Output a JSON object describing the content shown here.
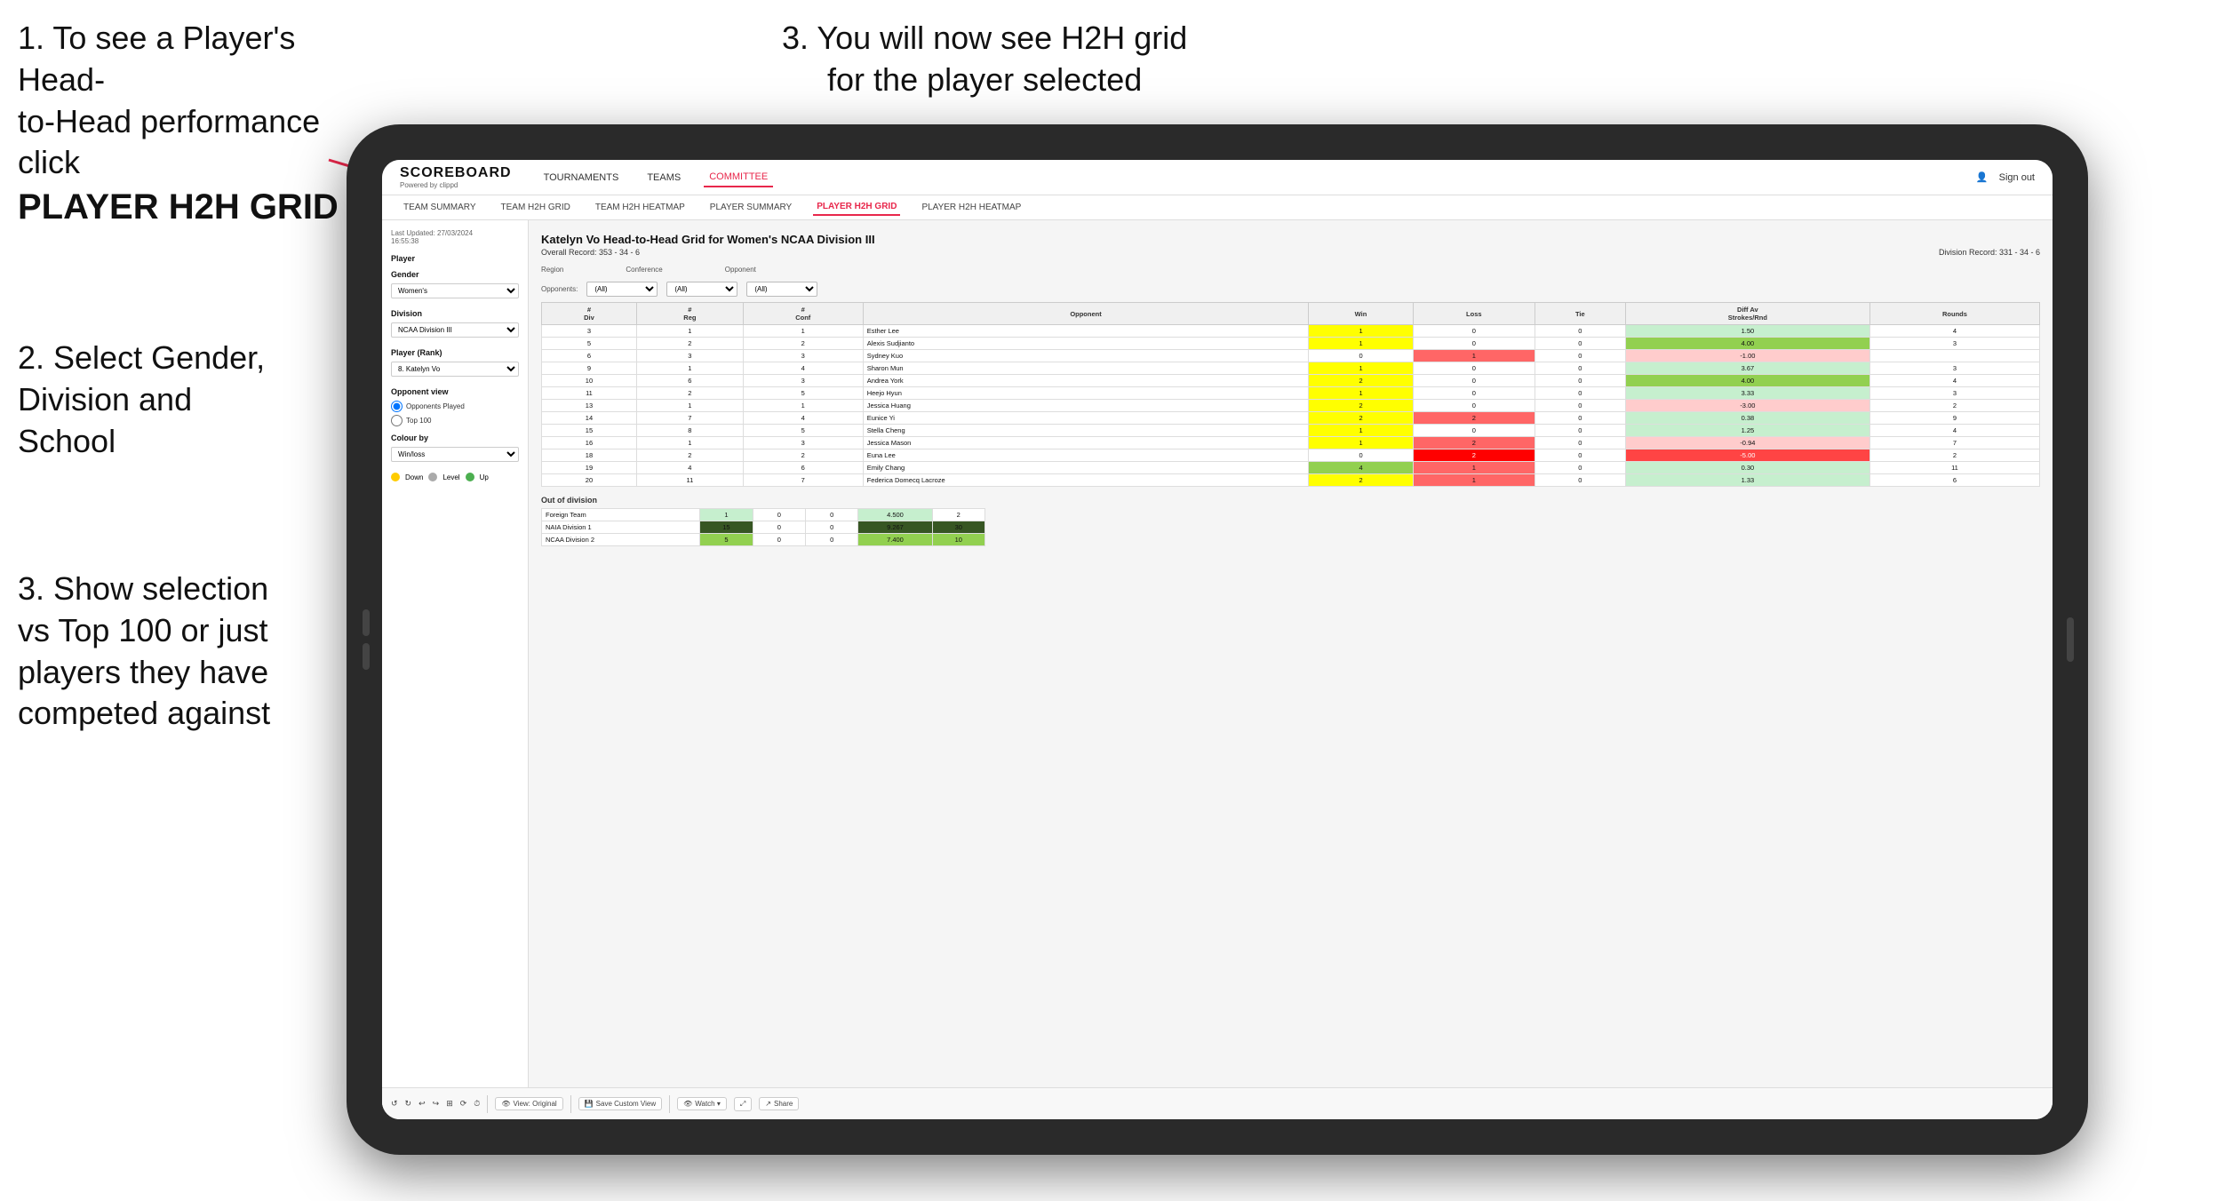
{
  "instructions": {
    "top_left_line1": "1. To see a Player's Head-",
    "top_left_line2": "to-Head performance click",
    "top_left_bold": "PLAYER H2H GRID",
    "top_right": "3. You will now see H2H grid\nfor the player selected",
    "mid_left_line1": "2. Select Gender,",
    "mid_left_line2": "Division and",
    "mid_left_line3": "School",
    "bottom_left_line1": "3. Show selection",
    "bottom_left_line2": "vs Top 100 or just",
    "bottom_left_line3": "players they have",
    "bottom_left_line4": "competed against"
  },
  "navbar": {
    "logo": "SCOREBOARD",
    "logo_sub": "Powered by clippd",
    "nav_items": [
      "TOURNAMENTS",
      "TEAMS",
      "COMMITTEE"
    ],
    "active_nav": "COMMITTEE",
    "sign_in": "Sign out"
  },
  "sub_navbar": {
    "items": [
      "TEAM SUMMARY",
      "TEAM H2H GRID",
      "TEAM H2H HEATMAP",
      "PLAYER SUMMARY",
      "PLAYER H2H GRID",
      "PLAYER H2H HEATMAP"
    ],
    "active": "PLAYER H2H GRID"
  },
  "sidebar": {
    "timestamp": "Last Updated: 27/03/2024\n16:55:38",
    "player_section": "Player",
    "gender_label": "Gender",
    "gender_value": "Women's",
    "division_label": "Division",
    "division_value": "NCAA Division III",
    "player_rank_label": "Player (Rank)",
    "player_rank_value": "8. Katelyn Vo",
    "opponent_view_label": "Opponent view",
    "radio_opponents": "Opponents Played",
    "radio_top100": "Top 100",
    "colour_by_label": "Colour by",
    "colour_by_value": "Win/loss",
    "legend_down": "Down",
    "legend_level": "Level",
    "legend_up": "Up"
  },
  "grid": {
    "title": "Katelyn Vo Head-to-Head Grid for Women's NCAA Division III",
    "overall_record": "Overall Record: 353 - 34 - 6",
    "division_record": "Division Record: 331 - 34 - 6",
    "region_label": "Region",
    "conference_label": "Conference",
    "opponent_label": "Opponent",
    "opponents_label": "Opponents:",
    "opponents_value": "(All)",
    "conference_filter": "(All)",
    "opponent_filter": "(All)",
    "table_headers": [
      "#\nDiv",
      "#\nReg",
      "#\nConf",
      "Opponent",
      "Win",
      "Loss",
      "Tie",
      "Diff Av\nStrokes/Rnd",
      "Rounds"
    ],
    "rows": [
      {
        "div": 3,
        "reg": 1,
        "conf": 1,
        "opponent": "Esther Lee",
        "win": 1,
        "loss": 0,
        "tie": 0,
        "diff": 1.5,
        "rounds": 4,
        "win_color": "yellow",
        "loss_color": "",
        "diff_color": "green"
      },
      {
        "div": 5,
        "reg": 2,
        "conf": 2,
        "opponent": "Alexis Sudjianto",
        "win": 1,
        "loss": 0,
        "tie": 0,
        "diff": 4.0,
        "rounds": 3,
        "win_color": "yellow",
        "loss_color": "",
        "diff_color": "green"
      },
      {
        "div": 6,
        "reg": 3,
        "conf": 3,
        "opponent": "Sydney Kuo",
        "win": 0,
        "loss": 1,
        "tie": 0,
        "diff": -1.0,
        "rounds": "",
        "win_color": "",
        "loss_color": "red",
        "diff_color": "light-red"
      },
      {
        "div": 9,
        "reg": 1,
        "conf": 4,
        "opponent": "Sharon Mun",
        "win": 1,
        "loss": 0,
        "tie": 0,
        "diff": 3.67,
        "rounds": 3,
        "win_color": "yellow",
        "loss_color": "",
        "diff_color": "green"
      },
      {
        "div": 10,
        "reg": 6,
        "conf": 3,
        "opponent": "Andrea York",
        "win": 2,
        "loss": 0,
        "tie": 0,
        "diff": 4.0,
        "rounds": 4,
        "win_color": "yellow",
        "loss_color": "",
        "diff_color": "green"
      },
      {
        "div": 11,
        "reg": 2,
        "conf": 5,
        "opponent": "Heejo Hyun",
        "win": 1,
        "loss": 0,
        "tie": 0,
        "diff": 3.33,
        "rounds": 3,
        "win_color": "yellow",
        "loss_color": "",
        "diff_color": "green"
      },
      {
        "div": 13,
        "reg": 1,
        "conf": 1,
        "opponent": "Jessica Huang",
        "win": 2,
        "loss": 0,
        "tie": 0,
        "diff": -3.0,
        "rounds": 2,
        "win_color": "yellow",
        "loss_color": "",
        "diff_color": "light-red"
      },
      {
        "div": 14,
        "reg": 7,
        "conf": 4,
        "opponent": "Eunice Yi",
        "win": 2,
        "loss": 2,
        "tie": 0,
        "diff": 0.38,
        "rounds": 9,
        "win_color": "yellow",
        "loss_color": "red",
        "diff_color": "green"
      },
      {
        "div": 15,
        "reg": 8,
        "conf": 5,
        "opponent": "Stella Cheng",
        "win": 1,
        "loss": 0,
        "tie": 0,
        "diff": 1.25,
        "rounds": 4,
        "win_color": "yellow",
        "loss_color": "",
        "diff_color": "green"
      },
      {
        "div": 16,
        "reg": 1,
        "conf": 3,
        "opponent": "Jessica Mason",
        "win": 1,
        "loss": 2,
        "tie": 0,
        "diff": -0.94,
        "rounds": 7,
        "win_color": "yellow",
        "loss_color": "red",
        "diff_color": "light-red"
      },
      {
        "div": 18,
        "reg": 2,
        "conf": 2,
        "opponent": "Euna Lee",
        "win": 0,
        "loss": 2,
        "tie": 0,
        "diff": -5.0,
        "rounds": 2,
        "win_color": "",
        "loss_color": "red",
        "diff_color": "red"
      },
      {
        "div": 19,
        "reg": 4,
        "conf": 6,
        "opponent": "Emily Chang",
        "win": 4,
        "loss": 1,
        "tie": 0,
        "diff": 0.3,
        "rounds": 11,
        "win_color": "yellow",
        "loss_color": "red",
        "diff_color": "green"
      },
      {
        "div": 20,
        "reg": 11,
        "conf": 7,
        "opponent": "Federica Domecq Lacroze",
        "win": 2,
        "loss": 1,
        "tie": 0,
        "diff": 1.33,
        "rounds": 6,
        "win_color": "yellow",
        "loss_color": "red",
        "diff_color": "green"
      }
    ],
    "out_of_division_label": "Out of division",
    "out_of_division_rows": [
      {
        "label": "Foreign Team",
        "win": 1,
        "loss": 0,
        "tie": 0,
        "diff": 4.5,
        "rounds": 2
      },
      {
        "label": "NAIA Division 1",
        "win": 15,
        "loss": 0,
        "tie": 0,
        "diff": 9.267,
        "rounds": 30
      },
      {
        "label": "NCAA Division 2",
        "win": 5,
        "loss": 0,
        "tie": 0,
        "diff": 7.4,
        "rounds": 10
      }
    ]
  },
  "toolbar": {
    "undo": "↺",
    "redo": "↻",
    "view_original": "View: Original",
    "save_custom": "Save Custom View",
    "watch": "Watch ▾",
    "share": "Share"
  }
}
